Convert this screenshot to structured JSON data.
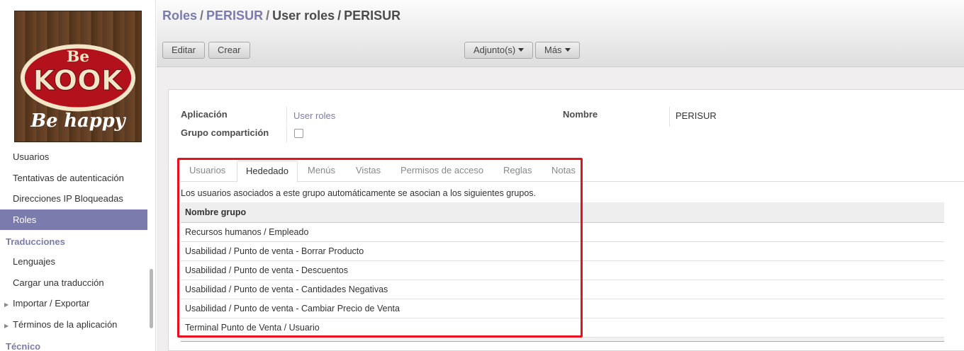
{
  "brand": {
    "logo_line1": "Be",
    "logo_line2": "KOOK",
    "logo_tagline": "Be happy",
    "colors": {
      "logo_red": "#b3121c",
      "logo_cream": "#f2e6c8",
      "wood": "#5a3a22"
    }
  },
  "sidebar": {
    "items": [
      {
        "label": "Usuarios",
        "type": "item"
      },
      {
        "label": "Tentativas de autenticación",
        "type": "item"
      },
      {
        "label": "Direcciones IP Bloqueadas",
        "type": "item"
      },
      {
        "label": "Roles",
        "type": "item",
        "active": true
      },
      {
        "label": "Traducciones",
        "type": "section"
      },
      {
        "label": "Lenguajes",
        "type": "item"
      },
      {
        "label": "Cargar una traducción",
        "type": "item"
      },
      {
        "label": "Importar / Exportar",
        "type": "caret"
      },
      {
        "label": "Términos de la aplicación",
        "type": "caret"
      },
      {
        "label": "Técnico",
        "type": "section"
      }
    ],
    "accent_color": "#7c7bad"
  },
  "header": {
    "breadcrumb": [
      {
        "label": "Roles",
        "link": true
      },
      {
        "label": "PERISUR",
        "link": true
      },
      {
        "label": "User roles",
        "link": false
      },
      {
        "label": "PERISUR",
        "link": false
      }
    ],
    "separator": "/",
    "buttons": {
      "edit": "Editar",
      "create": "Crear",
      "attachments": "Adjunto(s)",
      "more": "Más"
    }
  },
  "form": {
    "application_label": "Aplicación",
    "application_value": "User roles",
    "share_group_label": "Grupo compartición",
    "share_group_checked": false,
    "name_label": "Nombre",
    "name_value": "PERISUR"
  },
  "tabs": [
    {
      "label": "Usuarios",
      "active": false
    },
    {
      "label": "Hededado",
      "active": true
    },
    {
      "label": "Menús",
      "active": false
    },
    {
      "label": "Vistas",
      "active": false
    },
    {
      "label": "Permisos de acceso",
      "active": false
    },
    {
      "label": "Reglas",
      "active": false
    },
    {
      "label": "Notas",
      "active": false
    }
  ],
  "inherited": {
    "help_text": "Los usuarios asociados a este grupo automáticamente se asocian a los siguientes grupos.",
    "column_header": "Nombre grupo",
    "rows": [
      "Recursos humanos / Empleado",
      "Usabilidad / Punto de venta - Borrar Producto",
      "Usabilidad / Punto de venta - Descuentos",
      "Usabilidad / Punto de venta - Cantidades Negativas",
      "Usabilidad / Punto de venta - Cambiar Precio de Venta",
      "Terminal Punto de Venta / Usuario"
    ]
  },
  "annotation": {
    "highlight_color": "#e8101e"
  }
}
